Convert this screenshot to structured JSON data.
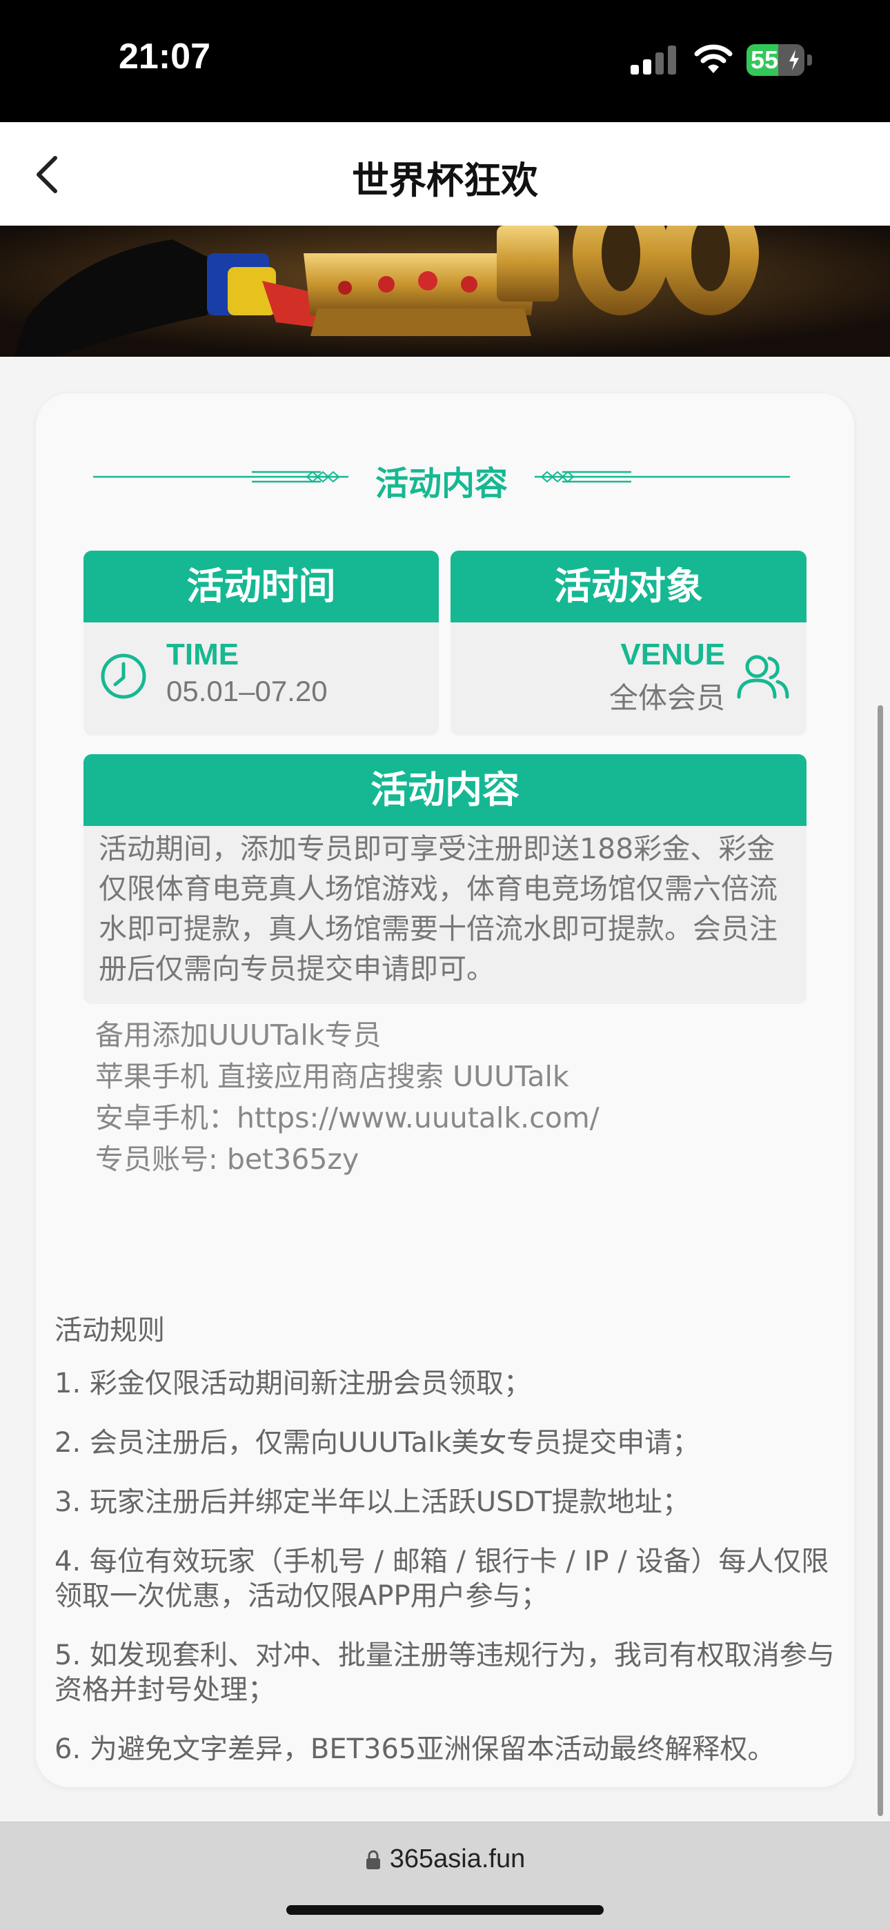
{
  "status_bar": {
    "time": "21:07",
    "battery": "55",
    "battery_level": 0.55,
    "icons": [
      "signal-icon",
      "wifi-icon",
      "battery-icon"
    ]
  },
  "nav": {
    "title": "世界杯狂欢",
    "back_icon": "chevron-left-icon"
  },
  "section_header": {
    "title": "活动内容"
  },
  "time_box": {
    "header": "活动时间",
    "label": "TIME",
    "value": "05.01–07.20",
    "icon": "clock-icon"
  },
  "target_box": {
    "header": "活动对象",
    "label": "VENUE",
    "value": "全体会员",
    "icon": "people-icon"
  },
  "content_box": {
    "header": "活动内容",
    "text": "活动期间，添加专员即可享受注册即送188彩金、彩金仅限体育电竞真人场馆游戏，体育电竞场馆仅需六倍流水即可提款，真人场馆需要十倍流水即可提款。会员注册后仅需向专员提交申请即可。"
  },
  "extra_info": [
    "备用添加UUUTalk专员",
    "苹果手机 直接应用商店搜索 UUUTalk",
    "安卓手机：https://www.uuutalk.com/",
    "专员账号: bet365zy"
  ],
  "rules": {
    "title": "活动规则",
    "items": [
      "1. 彩金仅限活动期间新注册会员领取；",
      "2. 会员注册后，仅需向UUUTalk美女专员提交申请；",
      "3. 玩家注册后并绑定半年以上活跃USDT提款地址；",
      "4. 每位有效玩家（手机号 / 邮箱 / 银行卡 / IP / 设备）每人仅限领取一次优惠，活动仅限APP用户参与；",
      "5. 如发现套利、对冲、批量注册等违规行为，我司有权取消参与资格并封号处理；",
      "6. 为避免文字差异，BET365亚洲保留本活动最终解释权。"
    ]
  },
  "browser": {
    "url": "365asia.fun",
    "lock_icon": "lock-icon"
  },
  "colors": {
    "accent": "#15b892",
    "status_bar": "#000000",
    "battery_green": "#33c759"
  }
}
